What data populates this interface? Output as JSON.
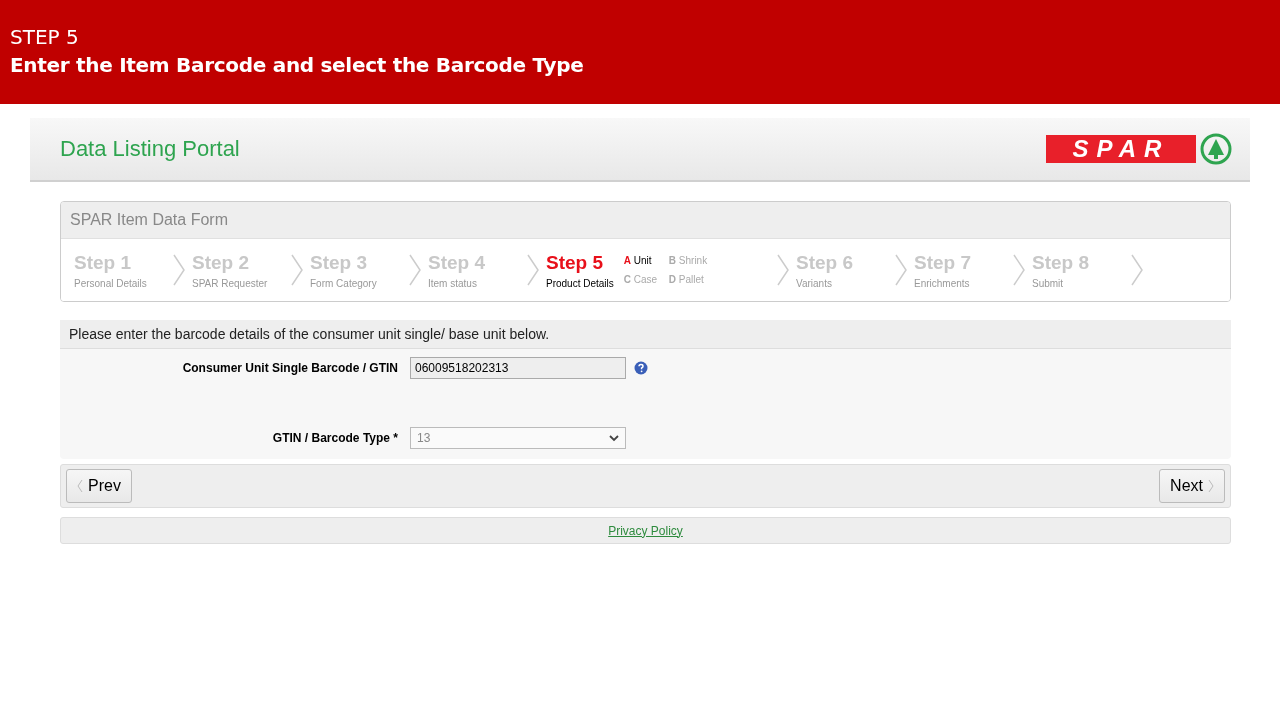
{
  "banner": {
    "step": "STEP 5",
    "instruction": "Enter the Item Barcode and select the Barcode Type"
  },
  "portal": {
    "title": "Data Listing Portal",
    "logo_text": "SPAR"
  },
  "form": {
    "title": "SPAR Item Data Form",
    "steps": [
      {
        "label": "Step 1",
        "sub": "Personal Details",
        "selected": false
      },
      {
        "label": "Step 2",
        "sub": "SPAR Requester",
        "selected": false
      },
      {
        "label": "Step 3",
        "sub": "Form Category",
        "selected": false
      },
      {
        "label": "Step 4",
        "sub": "Item status",
        "selected": false
      },
      {
        "label": "Step 5",
        "sub": "Product Details",
        "selected": true,
        "substeps": [
          {
            "letter": "A",
            "label": "Unit",
            "selected": true
          },
          {
            "letter": "B",
            "label": "Shrink",
            "selected": false
          },
          {
            "letter": "C",
            "label": "Case",
            "selected": false
          },
          {
            "letter": "D",
            "label": "Pallet",
            "selected": false
          }
        ]
      },
      {
        "label": "Step 6",
        "sub": "Variants",
        "selected": false
      },
      {
        "label": "Step 7",
        "sub": "Enrichments",
        "selected": false
      },
      {
        "label": "Step 8",
        "sub": "Submit",
        "selected": false
      }
    ]
  },
  "section": {
    "heading": "Please enter the barcode details of the consumer unit single/ base unit below.",
    "fields": [
      {
        "kind": "text",
        "label": "Consumer Unit Single Barcode / GTIN",
        "value": "06009518202313"
      },
      {
        "kind": "select",
        "label": "GTIN / Barcode Type *",
        "value": "13"
      }
    ]
  },
  "nav": {
    "prev": "Prev",
    "next": "Next"
  },
  "footer": {
    "link": "Privacy Policy"
  }
}
